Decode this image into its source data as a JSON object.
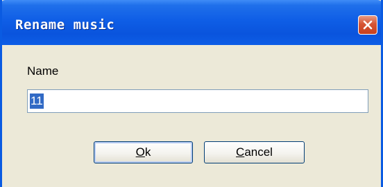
{
  "dialog": {
    "title": "Rename music",
    "close_icon": "close-icon",
    "name_label": "Name",
    "name_value": "11",
    "ok_button": {
      "mnemonic": "O",
      "rest": "k"
    },
    "cancel_button": {
      "mnemonic": "C",
      "rest": "ancel"
    }
  },
  "colors": {
    "titlebar": "#0a54dd",
    "window_body": "#ece9d8",
    "close_button": "#d65434",
    "selection": "#316ac5"
  }
}
